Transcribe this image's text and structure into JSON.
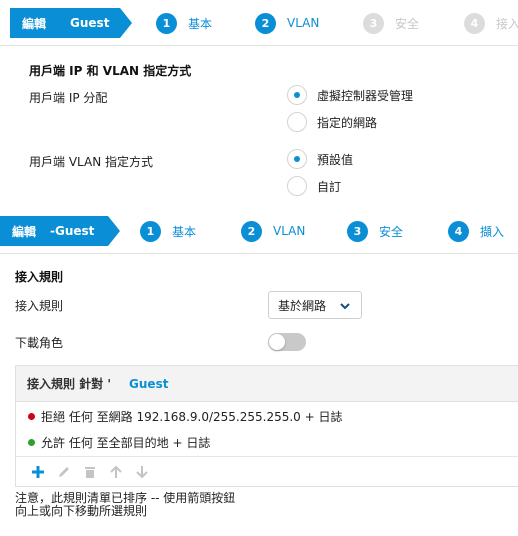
{
  "wizard_top": {
    "edit_label": "編輯",
    "edit_name": "Guest",
    "steps": [
      {
        "num": "1",
        "label": "基本",
        "state": "active"
      },
      {
        "num": "2",
        "label": "VLAN",
        "state": "active"
      },
      {
        "num": "3",
        "label": "安全",
        "state": "disabled"
      },
      {
        "num": "4",
        "label": "接入",
        "state": "disabled"
      }
    ]
  },
  "vlan_section": {
    "title": "用戶端 IP 和 VLAN 指定方式",
    "ip_label": "用戶端 IP 分配",
    "ip_options": [
      {
        "label": "虛擬控制器受管理",
        "selected": true
      },
      {
        "label": "指定的網路",
        "selected": false
      }
    ],
    "vlan_label": "用戶端 VLAN 指定方式",
    "vlan_options": [
      {
        "label": "預設值",
        "selected": true
      },
      {
        "label": "自訂",
        "selected": false
      }
    ]
  },
  "wizard_bottom": {
    "edit_label": "編輯",
    "edit_name": "-Guest",
    "steps": [
      {
        "num": "1",
        "label": "基本",
        "state": "active"
      },
      {
        "num": "2",
        "label": "VLAN",
        "state": "active"
      },
      {
        "num": "3",
        "label": "安全",
        "state": "active"
      },
      {
        "num": "4",
        "label": "擷入",
        "state": "active"
      }
    ]
  },
  "access_section": {
    "title": "接入規則",
    "rule_label": "接入規則",
    "rule_select_value": "基於網路",
    "download_role_label": "下載角色",
    "download_role_enabled": false,
    "rules_box": {
      "header_title": "接入規則 針對 '",
      "header_name": "Guest",
      "rows": [
        {
          "text": "拒絕 任何 至網路 192.168.9.0/255.255.255.0 + 日誌",
          "color": "#d0021b"
        },
        {
          "text": "允許 任何 至全部目的地 + 日誌",
          "color": "#2e9e2e"
        }
      ],
      "toolbar": [
        "plus-icon",
        "pencil-icon",
        "trash-icon",
        "arrow-up-icon",
        "arrow-down-icon"
      ]
    },
    "note_line1": "注意，此規則清單已排序 -- 使用箭頭按鈕",
    "note_line2": "向上或向下移動所選規則"
  },
  "colors": {
    "accent": "#0a8fd6",
    "disabled": "#c8c8c8"
  }
}
